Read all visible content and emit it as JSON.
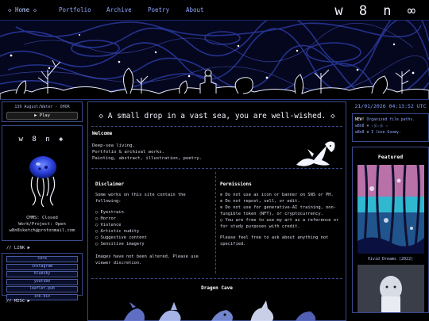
{
  "nav": {
    "home": "◇ Home ◇",
    "portfolio": "Portfolio",
    "archive": "Archive",
    "poetry": "Poetry",
    "about": "About",
    "brand": "w 8 n ∞"
  },
  "player": {
    "track": "139 August/Water - OHOR",
    "play_label": "▶ Play"
  },
  "profile": {
    "name": "w 8 n ◈",
    "status_lines": [
      "CMMS: Closed",
      "Work/Project: Open",
      "w8n8sketch@protonmail.com"
    ]
  },
  "links": {
    "header": "// LINK ▶",
    "items": [
      "cara",
      "instagram",
      "bluesky",
      "youtube",
      "leaflet.pub",
      "ink.bio"
    ]
  },
  "misc": {
    "header": "// MISC ▶"
  },
  "main": {
    "title": "◇ A small drop in a vast sea, you are well-wished. ◇",
    "welcome": {
      "heading": "Welcome",
      "lines": [
        "Deep-sea living.",
        "Portfolio & archival works.",
        "Painting, abstract, illustration, poetry."
      ]
    },
    "disclaimer": {
      "heading": "Disclaimer",
      "intro": "Some works on this site contain the following:",
      "items": [
        "○ Eyestrain",
        "○ Horror",
        "○ Violence",
        "○ Artistic nudity",
        "○ Suggestive content",
        "○ Sensitive imagery"
      ],
      "outro": "Images have not been altered. Please use viewer discretion."
    },
    "permissions": {
      "heading": "Permissions",
      "items": [
        "⊘ Do not use as icon or banner on SNS or PH.",
        "⊘ Do not repost, sell, or edit.",
        "⊘ Do not use for generative-AI training, non-fungible token (NFT), or cryptocurrency.",
        "○ You are free to use my art as a reference or for study purposes with credit."
      ],
      "outro": "Please feel free to ask about anything not specified."
    },
    "dragon_cave": {
      "heading": "Dragon Cave"
    }
  },
  "rightbar": {
    "clock": "21/01/2026 04:13:52 UTC",
    "news": [
      {
        "tag": "NEW!",
        "text": "Organized file paths."
      },
      {
        "tag": "w8n8 ❄",
        "text": "☆彡☆彡 ☆"
      },
      {
        "tag": "w8n8 ❤",
        "text": "I love Goomy."
      }
    ],
    "featured": {
      "heading": "Featured",
      "caption": "Vivid Dreams (2022)"
    }
  },
  "colors": {
    "background": "#000000",
    "accent": "#8fa6ff",
    "border": "#3a4a8a",
    "banner_bg": "#05071f"
  }
}
